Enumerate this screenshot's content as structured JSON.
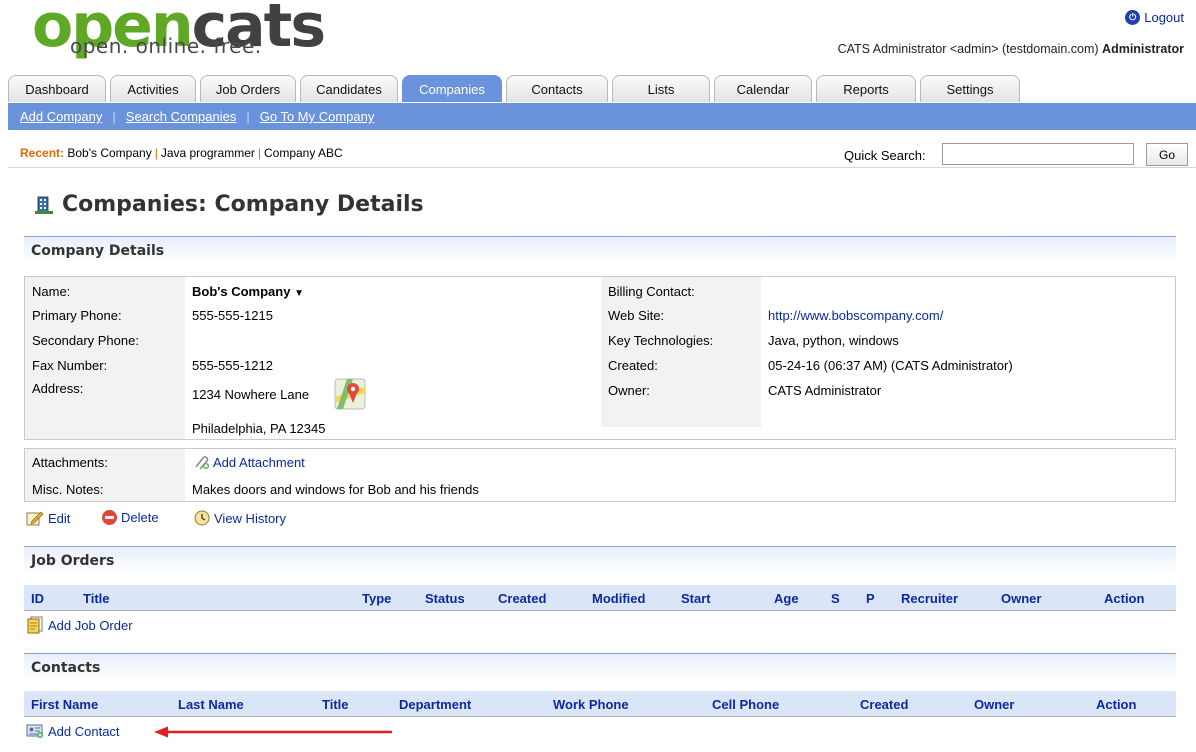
{
  "header": {
    "logo_main_a": "open",
    "logo_main_b": "cats",
    "logo_tagline": "open. online. free.",
    "logout_label": "Logout",
    "user_line": "CATS Administrator <admin> (testdomain.com)",
    "user_role": "Administrator"
  },
  "tabs": [
    {
      "label": "Dashboard"
    },
    {
      "label": "Activities"
    },
    {
      "label": "Job Orders"
    },
    {
      "label": "Candidates"
    },
    {
      "label": "Companies"
    },
    {
      "label": "Contacts"
    },
    {
      "label": "Lists"
    },
    {
      "label": "Calendar"
    },
    {
      "label": "Reports"
    },
    {
      "label": "Settings"
    }
  ],
  "subnav": {
    "add_company": "Add Company",
    "search_companies": "Search Companies",
    "go_to_my_company": "Go To My Company"
  },
  "recent": {
    "label": "Recent:",
    "items": [
      "Bob's Company",
      "Java programmer",
      "Company ABC"
    ]
  },
  "quick_search": {
    "label": "Quick Search:",
    "value": "",
    "button": "Go"
  },
  "page_title": "Companies: Company Details",
  "company_details": {
    "section_title": "Company Details",
    "name_label": "Name:",
    "name_value": "Bob's Company",
    "primary_phone_label": "Primary Phone:",
    "primary_phone_value": "555-555-1215",
    "secondary_phone_label": "Secondary Phone:",
    "secondary_phone_value": "",
    "fax_label": "Fax Number:",
    "fax_value": "555-555-1212",
    "address_label": "Address:",
    "address_line1": "1234 Nowhere Lane",
    "address_line2": "Philadelphia, PA 12345",
    "billing_contact_label": "Billing Contact:",
    "billing_contact_value": "",
    "website_label": "Web Site:",
    "website_value": "http://www.bobscompany.com/",
    "key_tech_label": "Key Technologies:",
    "key_tech_value": "Java, python, windows",
    "created_label": "Created:",
    "created_value": "05-24-16 (06:37 AM) (CATS Administrator)",
    "owner_label": "Owner:",
    "owner_value": "CATS Administrator",
    "attachments_label": "Attachments:",
    "add_attachment": "Add Attachment",
    "misc_notes_label": "Misc. Notes:",
    "misc_notes_value": "Makes doors and windows for Bob and his friends"
  },
  "detail_actions": {
    "edit": "Edit",
    "delete": "Delete",
    "view_history": "View History"
  },
  "job_orders": {
    "section_title": "Job Orders",
    "columns": [
      "ID",
      "Title",
      "Type",
      "Status",
      "Created",
      "Modified",
      "Start",
      "Age",
      "S",
      "P",
      "Recruiter",
      "Owner",
      "Action"
    ],
    "add_label": "Add Job Order"
  },
  "contacts": {
    "section_title": "Contacts",
    "columns": [
      "First Name",
      "Last Name",
      "Title",
      "Department",
      "Work Phone",
      "Cell Phone",
      "Created",
      "Owner",
      "Action"
    ],
    "add_label": "Add Contact"
  },
  "colors": {
    "tab_active": "#6a93db",
    "logo_green": "#5fa826",
    "link": "#0b2a9c",
    "recent_orange": "#e06a00",
    "arrow_red": "#e02020"
  }
}
